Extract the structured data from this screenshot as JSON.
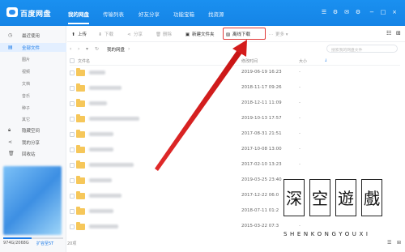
{
  "app": {
    "title": "百度网盘"
  },
  "nav_tabs": [
    {
      "label": "我的网盘"
    },
    {
      "label": "传输列表"
    },
    {
      "label": "好友分享"
    },
    {
      "label": "功能宝箱"
    },
    {
      "label": "找资源"
    }
  ],
  "window_controls": [
    "list-icon",
    "settings-icon",
    "mail-icon",
    "gear-icon",
    "minimize-icon",
    "maximize-icon",
    "close-icon"
  ],
  "sidebar": {
    "items": [
      {
        "label": "最近使用",
        "icon": "clock-icon"
      },
      {
        "label": "全部文件",
        "icon": "file-icon"
      },
      {
        "label": "隐藏空间",
        "icon": "lock-icon"
      },
      {
        "label": "我的分享",
        "icon": "share-icon"
      },
      {
        "label": "回收站",
        "icon": "trash-icon"
      }
    ],
    "subitems": [
      "图片",
      "视频",
      "文档",
      "音乐",
      "种子",
      "其它"
    ],
    "storage": "974G/2068G",
    "storage_fraction": 0.47,
    "expand_label": "扩容至5T"
  },
  "toolbar": {
    "upload": "上传",
    "download": "下载",
    "share": "分享",
    "delete": "删除",
    "new_folder": "新建文件夹",
    "offline_download": "离线下载",
    "more": "更多"
  },
  "breadcrumb": {
    "current": "我的网盘"
  },
  "search": {
    "placeholder": "搜索我的网盘文件"
  },
  "table": {
    "headers": {
      "name": "文件名",
      "modified": "修改时间",
      "size": "大小"
    },
    "rows": [
      {
        "modified": "2019-06-19 16:23",
        "size": "-"
      },
      {
        "modified": "2018-11-17 09:26",
        "size": "-"
      },
      {
        "modified": "2018-12-11 11:09",
        "size": "-"
      },
      {
        "modified": "2019-10-13 17:57",
        "size": "-"
      },
      {
        "modified": "2017-08-31 21:51",
        "size": "-"
      },
      {
        "modified": "2017-10-08 13:00",
        "size": "-"
      },
      {
        "modified": "2017-02-10 13:23",
        "size": "-"
      },
      {
        "modified": "2019-03-25 23:40",
        "size": "-"
      },
      {
        "modified": "2017-12-22 06:0",
        "size": "-"
      },
      {
        "modified": "2018-07-11 01:2",
        "size": "-"
      },
      {
        "modified": "2015-03-22 07:3",
        "size": "-"
      }
    ]
  },
  "status": {
    "count": "20项"
  },
  "watermark": {
    "chars": [
      "深",
      "空",
      "遊",
      "戲"
    ],
    "text": "SHENKONGYOUXI"
  },
  "annotation": {
    "arrow_color": "#e02a2a"
  }
}
